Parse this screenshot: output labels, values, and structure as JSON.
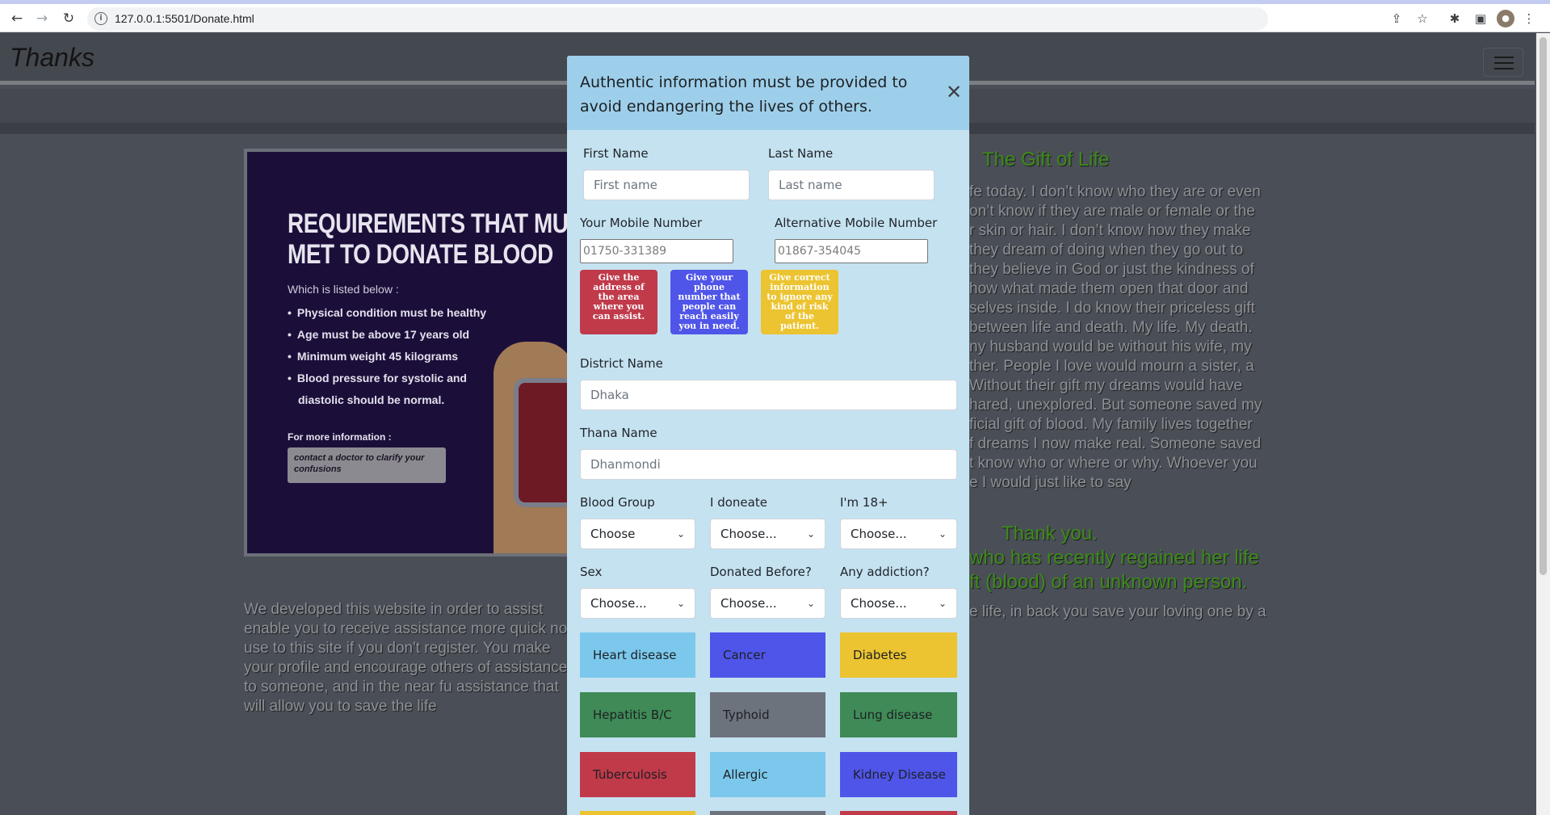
{
  "browser": {
    "url": "127.0.0.1:5501/Donate.html"
  },
  "site": {
    "brand": "Thanks"
  },
  "poster": {
    "heading_line1": "REQUIREMENTS THAT MUST BE",
    "heading_line2": "MET TO DONATE BLOOD",
    "sub": "Which is listed below :",
    "items": [
      "Physical condition must be healthy",
      "Age must be above 17 years old",
      "Minimum weight 45 kilograms",
      "Blood pressure for systolic and"
    ],
    "item_cont": "diastolic should be normal.",
    "more": "For more information :",
    "note": "contact a doctor to clarify your confusions"
  },
  "left_text": "We developed this website in order to assist enable you to receive assistance more quick no use to this site if you don't register. You make your profile and encourage others of assistance to someone, and in the near fu assistance that will allow you to save the life",
  "right": {
    "title": "The Gift of Life",
    "story": "fe today. I don’t know who they are or even\non’t know if they are male or female or the\nr skin or hair. I don’t know how they make\n they dream of doing when they go out to\n they believe in God or just the kindness of\nhow what made them open that door and\nselves inside. I do know their priceless gift\nbetween life and death. My life. My death.\nny husband would be without his wife, my\nther. People I love would mourn a sister, a\n Without their gift my dreams would have\nhared, unexplored. But someone saved my\nficial gift of blood. My family lives together\nf dreams I now make real. Someone saved\nt know who or where or why. Whoever you\ne I would just like to say",
    "thank_you": "Thank you.",
    "thanks_sub": "who has recently regained her life\nft (blood) of an unknown person.",
    "save_line": "e life, in back you save your loving one by a"
  },
  "modal": {
    "title": "Authentic information must be provided to avoid endangering the lives of others.",
    "first_name": {
      "label": "First Name",
      "placeholder": "First name"
    },
    "last_name": {
      "label": "Last Name",
      "placeholder": "Last name"
    },
    "mobile": {
      "label": "Your Mobile Number",
      "placeholder": "01750-331389"
    },
    "alt_mobile": {
      "label": "Alternative Mobile Number",
      "placeholder": "01867-354045"
    },
    "tips": [
      {
        "text": "Give the address of the area where you can assist.",
        "color": "#c03a4a"
      },
      {
        "text": "Give your phone number that people can reach easily you in need.",
        "color": "#4f55e8"
      },
      {
        "text": "Give correct information to ignore any kind of risk of the patient.",
        "color": "#ecc431"
      }
    ],
    "district": {
      "label": "District Name",
      "placeholder": "Dhaka"
    },
    "thana": {
      "label": "Thana Name",
      "placeholder": "Dhanmondi"
    },
    "selects_row1": [
      {
        "label": "Blood Group",
        "value": "Choose"
      },
      {
        "label": "I doneate",
        "value": "Choose..."
      },
      {
        "label": "I'm 18+",
        "value": "Choose..."
      }
    ],
    "selects_row2": [
      {
        "label": "Sex",
        "value": "Choose..."
      },
      {
        "label": "Donated Before?",
        "value": "Choose..."
      },
      {
        "label": "Any addiction?",
        "value": "Choose..."
      }
    ],
    "diseases": [
      {
        "label": "Heart disease",
        "color": "#7bc8ec"
      },
      {
        "label": "Cancer",
        "color": "#4f55e8"
      },
      {
        "label": "Diabetes",
        "color": "#ecc431"
      },
      {
        "label": "Hepatitis B/C",
        "color": "#3f8a56"
      },
      {
        "label": "Typhoid",
        "color": "#6c737d"
      },
      {
        "label": "Lung disease",
        "color": "#3f8a56"
      },
      {
        "label": "Tuberculosis",
        "color": "#c03a4a"
      },
      {
        "label": "Allergic",
        "color": "#7bc8ec"
      },
      {
        "label": "Kidney Disease",
        "color": "#4f55e8"
      }
    ]
  }
}
